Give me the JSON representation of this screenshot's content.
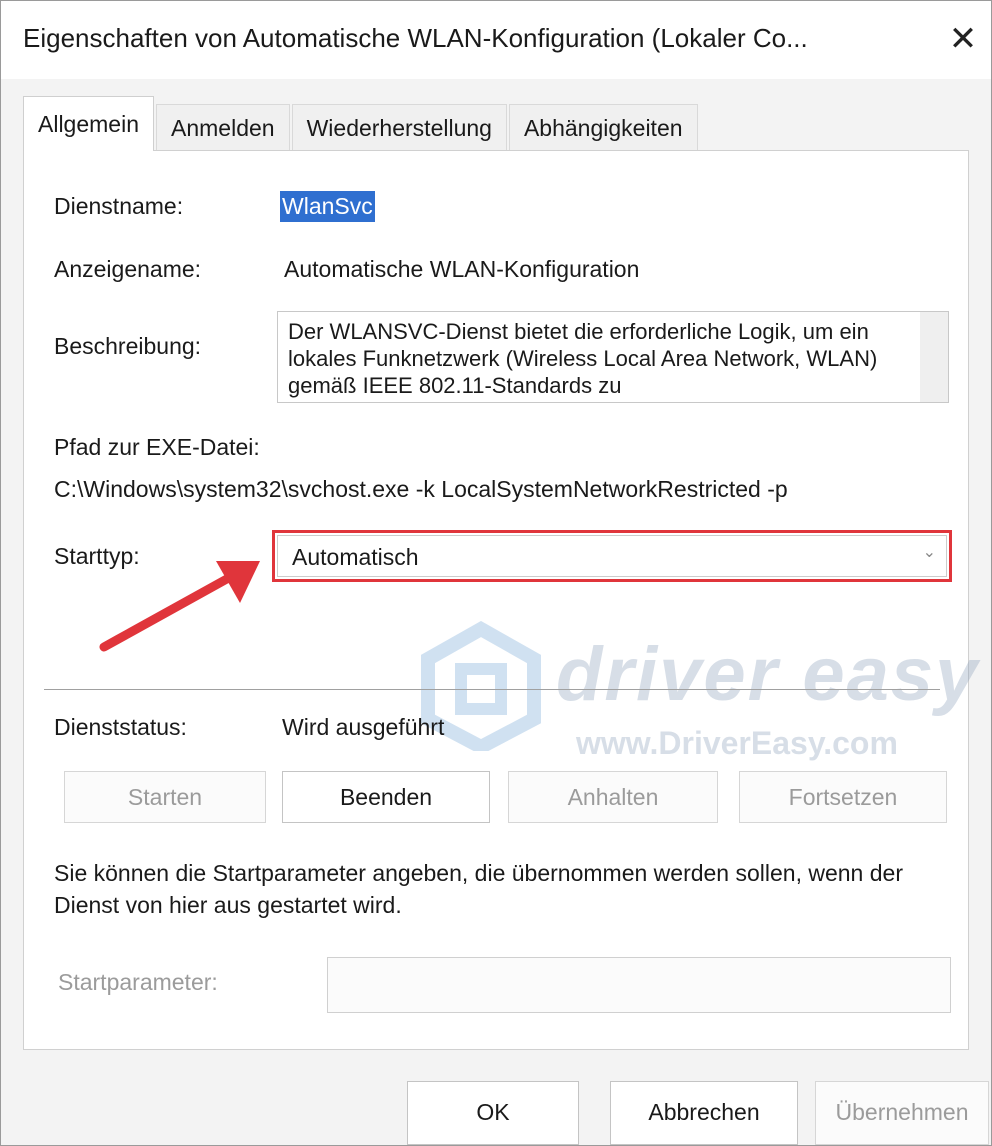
{
  "window": {
    "title": "Eigenschaften von Automatische WLAN-Konfiguration (Lokaler Co...",
    "close_glyph": "✕"
  },
  "tabs": [
    {
      "label": "Allgemein",
      "active": true
    },
    {
      "label": "Anmelden",
      "active": false
    },
    {
      "label": "Wiederherstellung",
      "active": false
    },
    {
      "label": "Abhängigkeiten",
      "active": false
    }
  ],
  "general": {
    "service_name_label": "Dienstname:",
    "service_name_value": "WlanSvc",
    "display_name_label": "Anzeigename:",
    "display_name_value": "Automatische WLAN-Konfiguration",
    "description_label": "Beschreibung:",
    "description_value": "Der WLANSVC-Dienst bietet die erforderliche Logik, um ein lokales Funknetzwerk (Wireless Local Area Network, WLAN) gemäß IEEE 802.11-Standards zu",
    "path_label": "Pfad zur EXE-Datei:",
    "path_value": "C:\\Windows\\system32\\svchost.exe -k LocalSystemNetworkRestricted -p",
    "startup_type_label": "Starttyp:",
    "startup_type_value": "Automatisch",
    "service_status_label": "Dienststatus:",
    "service_status_value": "Wird ausgeführt"
  },
  "service_buttons": {
    "start": "Starten",
    "stop": "Beenden",
    "pause": "Anhalten",
    "resume": "Fortsetzen"
  },
  "start_params": {
    "hint": "Sie können die Startparameter angeben, die übernommen werden sollen, wenn der Dienst von hier aus gestartet wird.",
    "label": "Startparameter:",
    "value": ""
  },
  "footer": {
    "ok": "OK",
    "cancel": "Abbrechen",
    "apply": "Übernehmen"
  },
  "watermark": {
    "brand": "driver easy",
    "url": "www.DriverEasy.com"
  },
  "colors": {
    "highlight_red": "#e0353b",
    "selection_blue": "#2f6fd0"
  }
}
